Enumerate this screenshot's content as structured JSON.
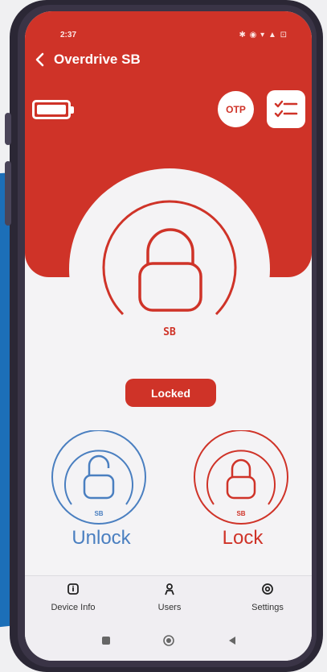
{
  "status_bar": {
    "time": "2:37",
    "icons": "✱ ◉ ▾ ▲ ⊡"
  },
  "app": {
    "title": "Overdrive SB",
    "brand_mark": "SB"
  },
  "header": {
    "otp_label": "OTP"
  },
  "lock_state": {
    "label": "Locked"
  },
  "actions": {
    "unlock": {
      "label": "Unlock",
      "mark": "SB",
      "color": "#4a7fc0"
    },
    "lock": {
      "label": "Lock",
      "mark": "SB",
      "color": "#cf3328"
    }
  },
  "bottom_nav": [
    {
      "label": "Device Info",
      "icon": "info-icon"
    },
    {
      "label": "Users",
      "icon": "user-icon"
    },
    {
      "label": "Settings",
      "icon": "settings-icon"
    }
  ],
  "colors": {
    "accent_red": "#cf3328",
    "accent_blue": "#4a7fc0",
    "screen_bg": "#f4f3f5"
  },
  "battery_level": 1.0
}
